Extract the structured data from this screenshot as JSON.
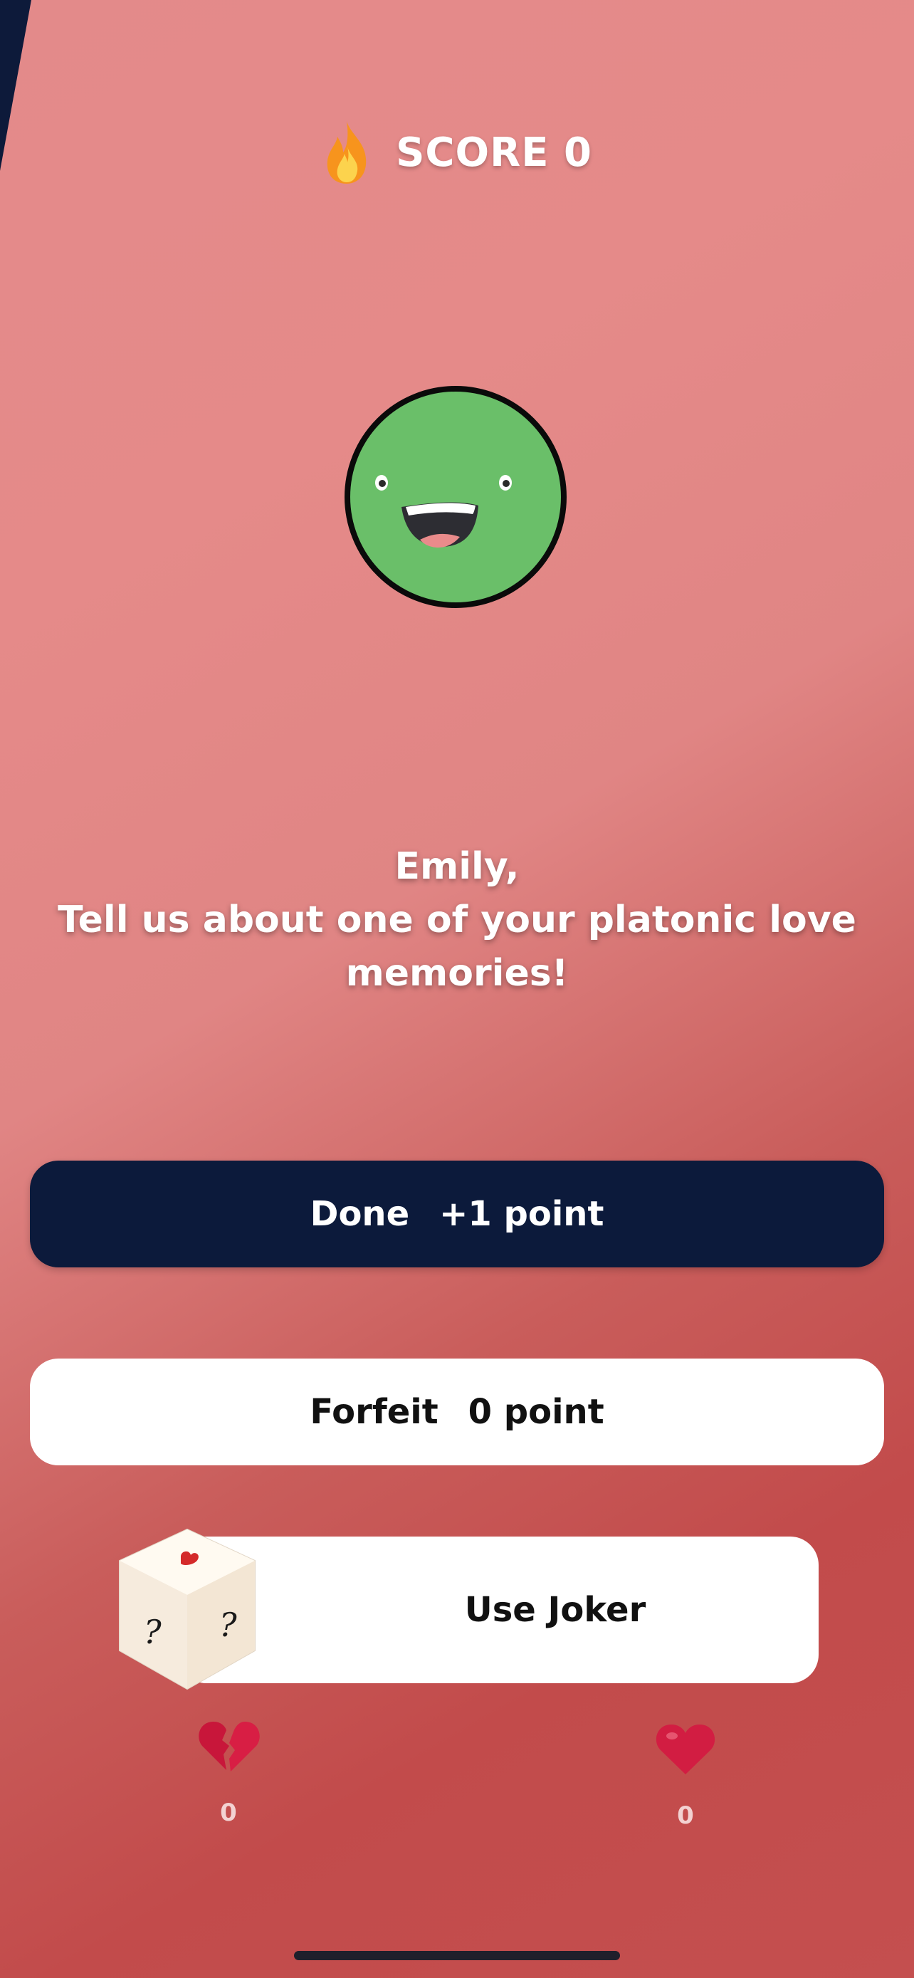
{
  "header": {
    "score_label": "SCORE 0",
    "icon": "fire-icon"
  },
  "avatar": {
    "icon": "smiling-face-icon",
    "color": "#6abf69"
  },
  "prompt": {
    "player_name": "Emily,",
    "question": "Tell us about one of your platonic love memories!"
  },
  "actions": {
    "done_label": "Done",
    "done_points": "+1 point",
    "forfeit_label": "Forfeit",
    "forfeit_points": "0 point",
    "joker_label": "Use Joker",
    "joker_icon": "dice-icon"
  },
  "stats": {
    "broken_hearts": {
      "icon": "broken-heart-icon",
      "count": "0"
    },
    "hearts": {
      "icon": "heart-icon",
      "count": "0"
    }
  },
  "colors": {
    "background_top": "#e38a8a",
    "background_bottom": "#c24b4b",
    "primary_button": "#0c1a3b",
    "secondary_button": "#ffffff",
    "text_light": "#ffffff"
  }
}
